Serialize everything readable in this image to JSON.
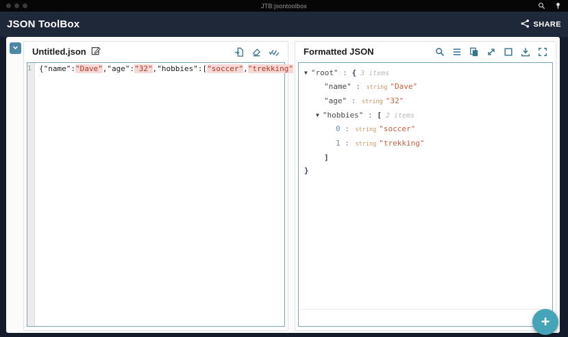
{
  "window": {
    "title": "JTB:jsontoolbox",
    "icons": [
      "search-icon",
      "pin-icon"
    ],
    "traffic_lights": 3
  },
  "appbar": {
    "title": "JSON ToolBox",
    "share_label": "SHARE"
  },
  "colors": {
    "header_navy": "#1e2838",
    "titlebar_black": "#060606",
    "accent_icon_blue": "#35758f",
    "collapse_button_blue": "#4c87a5",
    "inner_border_teal": "#7aa7b4",
    "fab_teal": "#46a4b8",
    "string_value_red": "#b5372a",
    "tree_value_orange": "#c75f3e"
  },
  "editor_panel": {
    "title": "Untitled.json",
    "toolbar_icons": [
      "import-file-icon",
      "erase-icon",
      "format-validate-icon"
    ],
    "line_number": "1",
    "tokens": [
      {
        "text": "{",
        "type": "punct"
      },
      {
        "text": "\"name\"",
        "type": "key"
      },
      {
        "text": ":",
        "type": "punct"
      },
      {
        "text": "\"Dave\"",
        "type": "value"
      },
      {
        "text": ",",
        "type": "punct"
      },
      {
        "text": "\"age\"",
        "type": "key"
      },
      {
        "text": ":",
        "type": "punct"
      },
      {
        "text": "\"32\"",
        "type": "value"
      },
      {
        "text": ",",
        "type": "punct"
      },
      {
        "text": "\"hobbies\"",
        "type": "key"
      },
      {
        "text": ":",
        "type": "punct"
      },
      {
        "text": "[",
        "type": "punct"
      },
      {
        "text": "\"soccer\"",
        "type": "value"
      },
      {
        "text": ",",
        "type": "punct"
      },
      {
        "text": "\"trekking\"",
        "type": "value"
      },
      {
        "text": "]}",
        "type": "punct"
      }
    ]
  },
  "formatted_panel": {
    "title": "Formatted JSON",
    "toolbar_icons": [
      "search-icon",
      "expand-levels-icon",
      "copy-icon",
      "collapse-icon",
      "select-box-icon",
      "download-icon",
      "fullscreen-icon"
    ],
    "tree_rows": [
      {
        "indent": 0,
        "toggle": true,
        "key": "\"root\"",
        "colon": " : ",
        "bracket": "{",
        "badge": "3 items"
      },
      {
        "indent": 1,
        "key": "\"name\"",
        "colon": " : ",
        "type": "string",
        "value": "\"Dave\""
      },
      {
        "indent": 1,
        "key": "\"age\"",
        "colon": " : ",
        "type": "string",
        "value": "\"32\""
      },
      {
        "indent": 1,
        "toggle": true,
        "key": "\"hobbies\"",
        "colon": " : ",
        "bracket": "[",
        "badge": "2 items"
      },
      {
        "indent": 2,
        "key": "0",
        "index": true,
        "colon": " : ",
        "type": "string",
        "value": "\"soccer\""
      },
      {
        "indent": 2,
        "key": "1",
        "index": true,
        "colon": " : ",
        "type": "string",
        "value": "\"trekking\""
      },
      {
        "indent": 1,
        "close": true,
        "bracket": "]"
      },
      {
        "indent": 0,
        "close": true,
        "bracket": "}"
      }
    ]
  },
  "fab": {
    "label": "+"
  }
}
